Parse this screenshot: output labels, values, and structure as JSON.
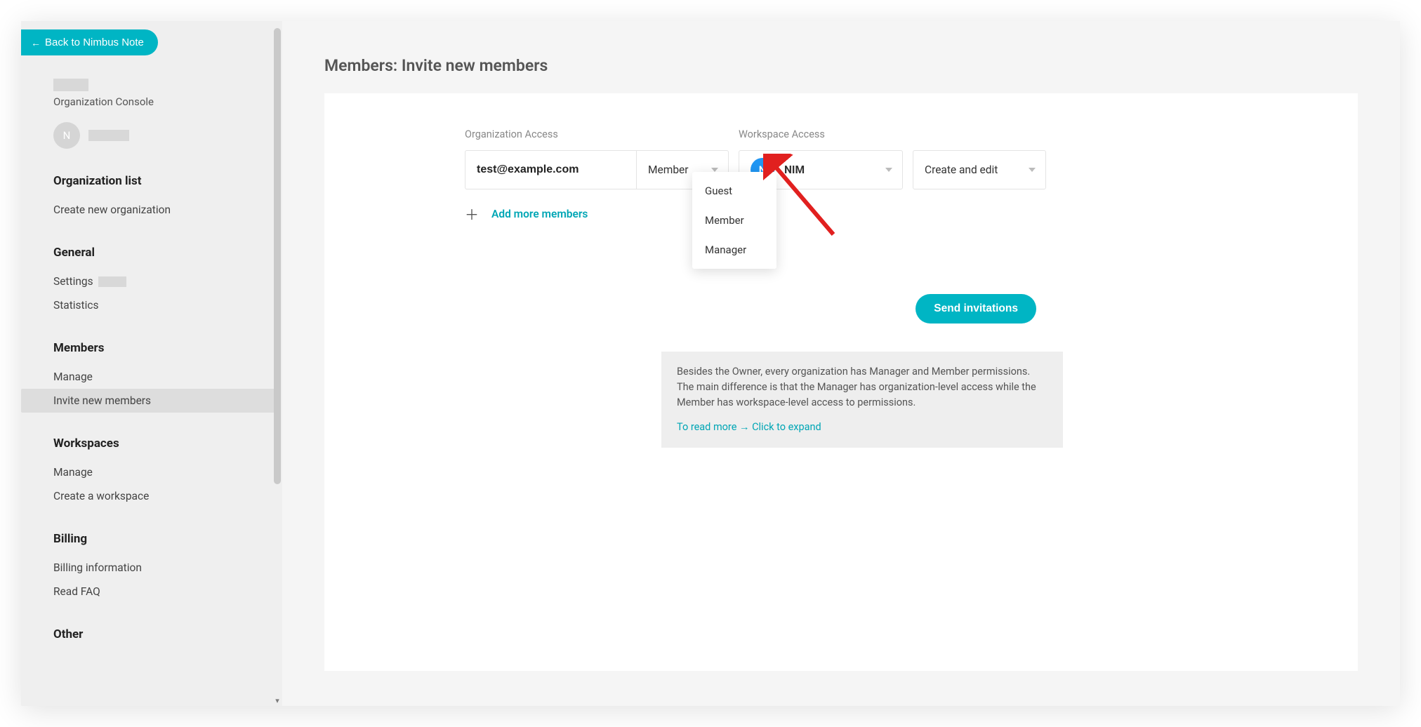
{
  "back_button": "Back to Nimbus Note",
  "org_console_label": "Organization Console",
  "user_avatar_letter": "N",
  "sidebar": {
    "sections": [
      {
        "heading": "Organization list",
        "items": [
          {
            "label": "Create new organization"
          }
        ]
      },
      {
        "heading": "General",
        "items": [
          {
            "label": "Settings",
            "has_redact": true
          },
          {
            "label": "Statistics"
          }
        ]
      },
      {
        "heading": "Members",
        "items": [
          {
            "label": "Manage"
          },
          {
            "label": "Invite new members",
            "active": true
          }
        ]
      },
      {
        "heading": "Workspaces",
        "items": [
          {
            "label": "Manage"
          },
          {
            "label": "Create a workspace"
          }
        ]
      },
      {
        "heading": "Billing",
        "items": [
          {
            "label": "Billing information"
          },
          {
            "label": "Read FAQ"
          }
        ]
      },
      {
        "heading": "Other",
        "items": []
      }
    ]
  },
  "page_title": "Members: Invite new members",
  "labels": {
    "org_access": "Organization Access",
    "ws_access": "Workspace Access"
  },
  "form": {
    "email": "test@example.com",
    "role_selected": "Member",
    "role_options": [
      "Guest",
      "Member",
      "Manager"
    ],
    "workspace_badge": "N",
    "workspace_name": "NIM",
    "permission_selected": "Create and edit"
  },
  "add_more": "Add more members",
  "send_button": "Send invitations",
  "info": {
    "text": "Besides the Owner, every organization has Manager and Member permissions. The main difference is that the Manager has organization-level access while the Member has workspace-level access to permissions.",
    "link": "To read more → Click to expand"
  }
}
